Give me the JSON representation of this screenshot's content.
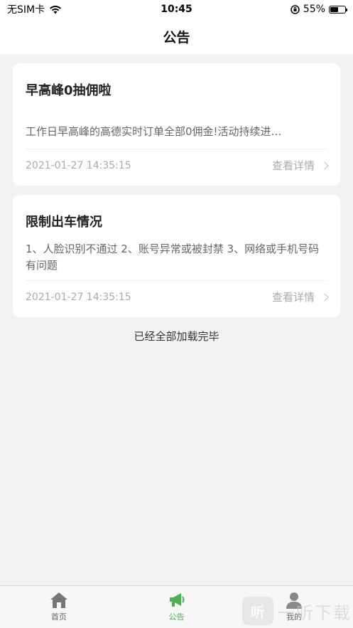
{
  "status_bar": {
    "carrier": "无SIM卡",
    "time": "10:45",
    "battery_text": "55%",
    "battery_level": 0.55
  },
  "nav": {
    "title": "公告"
  },
  "notices": [
    {
      "title": "早高峰0抽佣啦",
      "body": "工作日早高峰的高德实时订单全部0佣金!活动持续进…",
      "date": "2021-01-27 14:35:15",
      "detail_label": "查看详情"
    },
    {
      "title": "限制出车情况",
      "body": "1、人脸识别不通过 2、账号异常或被封禁  3、网络或手机号码有问题",
      "date": "2021-01-27 14:35:15",
      "detail_label": "查看详情"
    }
  ],
  "load_complete": "已经全部加载完毕",
  "tabs": [
    {
      "label": "首页",
      "icon": "home-icon",
      "active": false
    },
    {
      "label": "公告",
      "icon": "megaphone-icon",
      "active": true
    },
    {
      "label": "我的",
      "icon": "person-icon",
      "active": false
    }
  ],
  "watermark": {
    "logo": "听",
    "text": "一听下载"
  },
  "colors": {
    "accent": "#4caf50"
  }
}
